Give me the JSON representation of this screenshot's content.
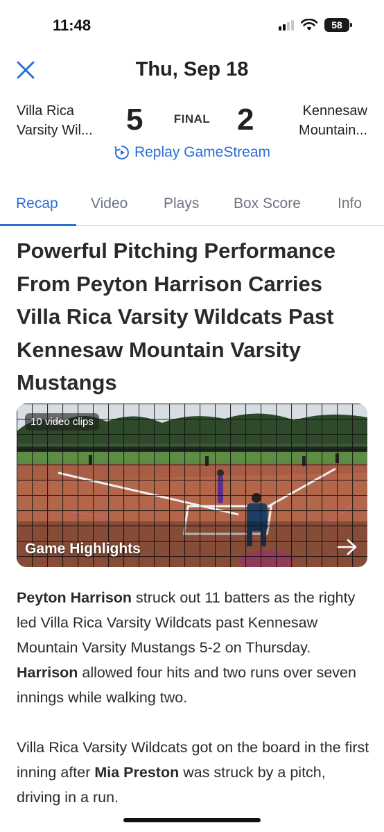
{
  "status_bar": {
    "time": "11:48",
    "battery": "58"
  },
  "header": {
    "date": "Thu, Sep 18"
  },
  "scoreboard": {
    "home_team_line1": "Villa Rica",
    "home_team_line2": "Varsity Wil...",
    "home_score": "5",
    "status": "FINAL",
    "away_score": "2",
    "away_team_line1": "Kennesaw",
    "away_team_line2": "Mountain..."
  },
  "replay": {
    "label": "Replay GameStream"
  },
  "tabs": [
    {
      "label": "Recap",
      "active": true
    },
    {
      "label": "Video",
      "active": false
    },
    {
      "label": "Plays",
      "active": false
    },
    {
      "label": "Box Score",
      "active": false
    },
    {
      "label": "Info",
      "active": false
    }
  ],
  "headline": "Powerful Pitching Performance From Peyton Harrison Carries Villa Rica Varsity Wildcats Past Kennesaw Mountain Varsity Mustangs",
  "video": {
    "clips_badge": "10 video clips",
    "title": "Game Highlights"
  },
  "article": {
    "p1_name": "Peyton Harrison",
    "p1_text_a": " struck out 11 batters as the righty led Villa Rica Varsity Wildcats past Kennesaw Mountain Varsity Mustangs 5-2 on Thursday. ",
    "p1_name2": "Harrison",
    "p1_text_b": " allowed four hits and two runs over seven innings while walking two.",
    "p2_text_a": "Villa Rica Varsity Wildcats got on the board in the first inning after ",
    "p2_name": "Mia Preston",
    "p2_text_b": " was struck by a pitch, driving in a run."
  },
  "colors": {
    "accent": "#2a6fd6",
    "text": "#222222",
    "tab_inactive": "#6b7480"
  }
}
